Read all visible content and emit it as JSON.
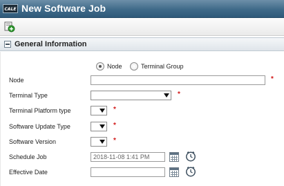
{
  "window": {
    "logo_text": "CALE",
    "title": "New Software Job"
  },
  "toolbar": {
    "buttons": [
      {
        "icon": "add-green-icon",
        "label": ""
      }
    ]
  },
  "section": {
    "title": "General Information",
    "collapse_icon": "collapse-minus-icon"
  },
  "target_type": {
    "options": [
      "Node",
      "Terminal Group"
    ],
    "selected": "Node"
  },
  "fields": {
    "node": {
      "label": "Node",
      "value": "",
      "required": "*"
    },
    "terminal_type": {
      "label": "Terminal Type",
      "value": "",
      "required": "*"
    },
    "terminal_platform_type": {
      "label": "Terminal Platform type",
      "value": "",
      "required": "*"
    },
    "software_update_type": {
      "label": "Software Update Type",
      "value": "",
      "required": "*"
    },
    "software_version": {
      "label": "Software Version",
      "value": "",
      "required": "*"
    },
    "schedule_job": {
      "label": "Schedule Job",
      "value": "2018-11-08 1:41 PM"
    },
    "effective_date": {
      "label": "Effective Date",
      "value": ""
    }
  },
  "colors": {
    "titlebar": "#3f6a89",
    "required": "#d21a1a",
    "section_bg": "#dfe5ea"
  }
}
